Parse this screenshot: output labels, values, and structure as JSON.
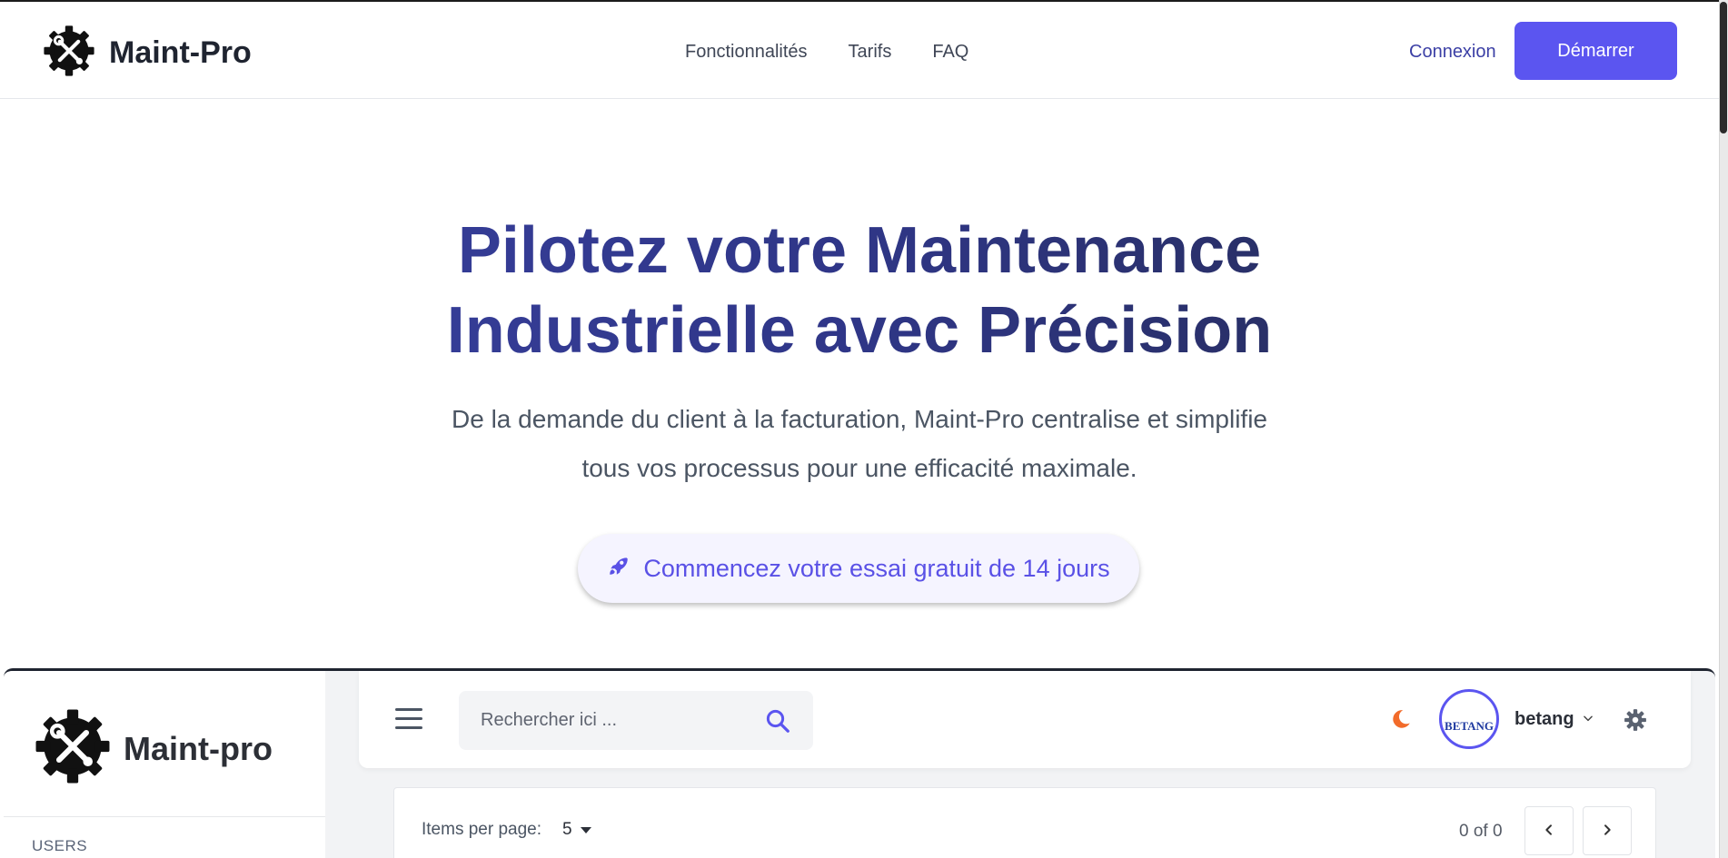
{
  "nav": {
    "brand": "Maint-Pro",
    "links": [
      "Fonctionnalités",
      "Tarifs",
      "FAQ"
    ],
    "login": "Connexion",
    "start": "Démarrer"
  },
  "hero": {
    "title_line1": "Pilotez votre Maintenance",
    "title_line2": "Industrielle avec Précision",
    "subtitle_line1": "De la demande du client à la facturation, Maint-Pro centralise et simplifie",
    "subtitle_line2": "tous vos processus pour une efficacité maximale.",
    "cta": "Commencez votre essai gratuit de 14 jours"
  },
  "app": {
    "brand": "Maint-pro",
    "sidebar_section": "USERS",
    "search_placeholder": "Rechercher ici ...",
    "avatar_text": "BETANG",
    "user_name": "betang",
    "items_per_page_label": "Items per page:",
    "items_per_page_value": "5",
    "page_count": "0 of 0"
  },
  "colors": {
    "primary": "#5b55f0",
    "heading_start": "#3b43a6",
    "heading_end": "#222845",
    "moon": "#f26b2a"
  },
  "icons": [
    "gear-wrench-logo-icon",
    "rocket-icon",
    "menu-icon",
    "search-icon",
    "moon-icon",
    "chevron-down-icon",
    "settings-gear-icon",
    "chevron-left-icon",
    "chevron-right-icon",
    "caret-down-icon"
  ]
}
